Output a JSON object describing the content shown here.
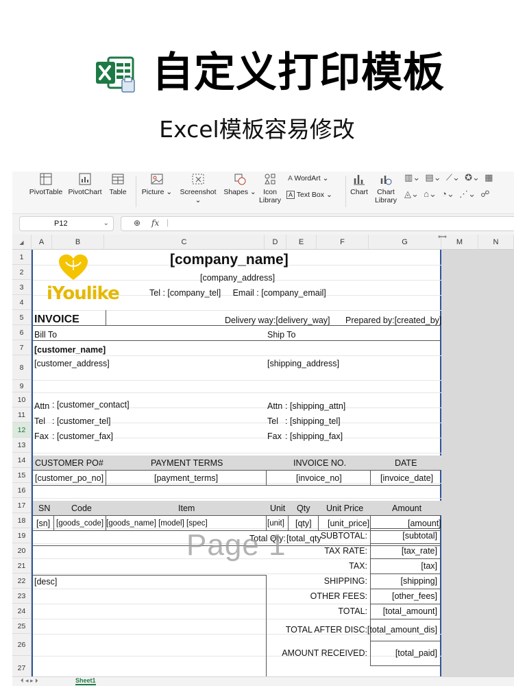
{
  "hero": {
    "title": "自定义打印模板",
    "subtitle": "Excel模板容易修改"
  },
  "colors": {
    "excel_green": "#1d7a45",
    "accent_border": "#2f5597",
    "header_fill": "#d9d9d9"
  },
  "ribbon": {
    "pivottable": "PivotTable",
    "pivotchart": "PivotChart",
    "table": "Table",
    "picture": "Picture",
    "screenshot": "Screenshot",
    "shapes": "Shapes",
    "icon_line1": "Icon",
    "icon_line2": "Library",
    "wordart": "WordArt",
    "textbox": "Text Box",
    "chart": "Chart",
    "chartlib_line1": "Chart",
    "chartlib_line2": "Library"
  },
  "formula_bar": {
    "name_box": "P12",
    "fx": "fx",
    "zoom_icon": "magnifier-icon"
  },
  "columns": [
    "A",
    "B",
    "C",
    "D",
    "E",
    "F",
    "G",
    "M",
    "N"
  ],
  "rows": [
    "1",
    "2",
    "3",
    "4",
    "5",
    "6",
    "7",
    "8",
    "9",
    "10",
    "11",
    "12",
    "13",
    "14",
    "15",
    "16",
    "17",
    "18",
    "19",
    "20",
    "21",
    "22",
    "23",
    "24",
    "25",
    "26",
    "27"
  ],
  "logo": {
    "text": "iYoulike"
  },
  "invoice": {
    "company_name": "[company_name]",
    "company_address": "[company_address]",
    "tel_line": "Tel : [company_tel]     Email : [company_email]",
    "invoice_title": "INVOICE",
    "delivery": "Delivery way:[delivery_way]",
    "prepared": "Prepared by:[created_by]",
    "bill_to": "Bill To",
    "ship_to": "Ship To",
    "customer_name": "[customer_name]",
    "customer_address": "[customer_address]",
    "shipping_address": "[shipping_address]",
    "attn_label": "Attn",
    "tel_label": "Tel",
    "fax_label": "Fax",
    "customer_contact": ": [customer_contact]",
    "customer_tel": ": [customer_tel]",
    "customer_fax": ": [customer_fax]",
    "shipping_attn": ": [shipping_attn]",
    "shipping_tel": ": [shipping_tel]",
    "shipping_fax": ": [shipping_fax]",
    "hdr_po": "CUSTOMER PO#",
    "hdr_terms": "PAYMENT TERMS",
    "hdr_invno": "INVOICE NO.",
    "hdr_date": "DATE",
    "val_po": "[customer_po_no]",
    "val_terms": "[payment_terms]",
    "val_invno": "[invoice_no]",
    "val_date": "[invoice_date]",
    "items_hdr": [
      "SN",
      "Code",
      "Item",
      "Unit",
      "Qty",
      "Unit Price",
      "Amount"
    ],
    "items_row": [
      "[sn]",
      "[goods_code]",
      "[goods_name] [model] [spec]",
      "[unit]",
      "[qty]",
      "[unit_price]",
      "[amount]"
    ],
    "total_qty_label": "Total Qty:",
    "total_qty": "[total_qty",
    "desc": "[desc]",
    "summary": [
      {
        "label": "SUBTOTAL:",
        "value": "[subtotal]"
      },
      {
        "label": "TAX RATE:",
        "value": "[tax_rate]"
      },
      {
        "label": "TAX:",
        "value": "[tax]"
      },
      {
        "label": "SHIPPING:",
        "value": "[shipping]"
      },
      {
        "label": "OTHER FEES:",
        "value": "[other_fees]"
      },
      {
        "label": "TOTAL:",
        "value": "[total_amount]"
      },
      {
        "label": "TOTAL AFTER DISC:",
        "value": "[total_amount_dis]"
      },
      {
        "label": "AMOUNT RECEIVED:",
        "value": "[total_paid]"
      }
    ]
  },
  "watermark": "Page 1",
  "sheet_tab": "Sheet1"
}
